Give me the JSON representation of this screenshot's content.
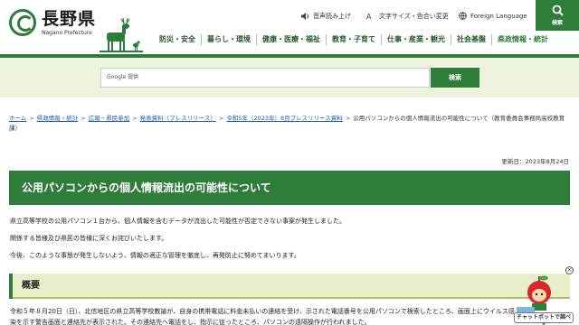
{
  "header": {
    "logo_ja": "長野県",
    "logo_en": "Nagano Prefecture",
    "util": {
      "voice": "音声読み上げ",
      "textsize": "文字サイズ・色合い変更",
      "language": "Foreign Language"
    },
    "search_label": "検索",
    "nav": [
      "防災・安全",
      "暮らし・環境",
      "健康・医療・福祉",
      "教育・子育て",
      "仕事・産業・観光",
      "社会基盤",
      "県政情報・統計"
    ]
  },
  "search": {
    "placeholder": "Google 提供",
    "button": "検索"
  },
  "breadcrumb": [
    "ホーム",
    "県政情報・統計",
    "広報・県民参加",
    "発表資料（プレスリリース）",
    "令和5年（2023年）8月プレスリリース資料",
    "公用パソコンからの個人情報流出の可能性について（教育委員会事務局高校教育課）"
  ],
  "updated": "更新日：2023年8月24日",
  "title": "公用パソコンからの個人情報流出の可能性について",
  "paragraphs": [
    "県立高等学校の公用パソコン１台から、個人情報を含むデータが流出した可能性が否定できない事案が発生しました。",
    "関係する皆様及び県民の皆様に深くお詫びいたします。",
    "今後、このような事態が発生しないよう、情報の適正な管理を徹底し、再発防止に努めてまいります。"
  ],
  "section": {
    "heading": "概要",
    "body": "令和５年８月20日（日）、北信地区の県立高等学校教諭が、自身の携帯電話に料金未払いの連絡を受け、示された電話番号を公用パソコンで検索したところ、画面上にウイルス感染を示す警告画面と連絡先が表示された。その連絡先へ電話をし、指示に従ったところ、パソコンの遠隔操作が行われました。"
  },
  "chatbot": {
    "label": "チャットボットで調べる",
    "close": "×"
  },
  "colors": {
    "brand_green": "#2f7d3a",
    "band": "#eef3dd",
    "link": "#1a5fa8"
  }
}
